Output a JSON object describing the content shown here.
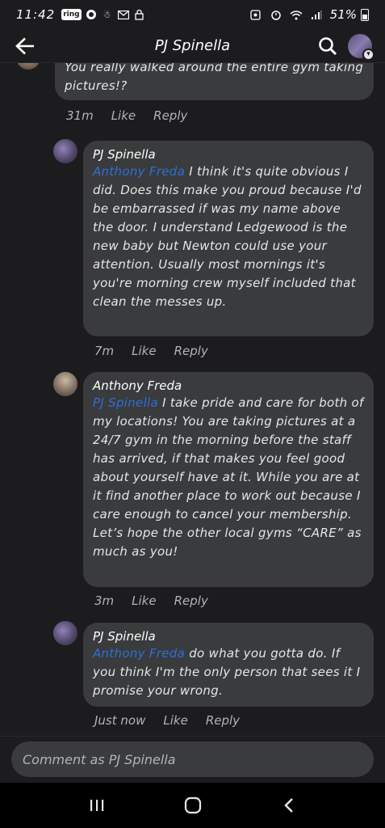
{
  "status_bar": {
    "time": "11:42",
    "ring_label": "ring",
    "battery": "51%"
  },
  "header": {
    "title": "PJ Spinella"
  },
  "comments": [
    {
      "author": "",
      "mention": "",
      "text": "You really walked around the entire gym taking pictures!?",
      "time": "31m",
      "like": "Like",
      "reply": "Reply"
    },
    {
      "author": "PJ Spinella",
      "mention": "Anthony Freda",
      "text": " I think it's quite obvious I did. Does this make you proud because I'd be embarrassed if was my name above the door. I understand Ledgewood is the new baby but Newton could use your attention. Usually most mornings it's you're morning crew myself included that clean the messes up.",
      "time": "7m",
      "like": "Like",
      "reply": "Reply"
    },
    {
      "author": "Anthony Freda",
      "mention": "PJ Spinella",
      "text": " I take pride and care for both of my locations! You are taking pictures at a 24/7 gym in the morning before the staff has arrived, if that makes you feel good about yourself have at it. While you are at it find another place to work out because I care enough to cancel your membership. Let’s hope the other local gyms “CARE” as much as you!",
      "time": "3m",
      "like": "Like",
      "reply": "Reply"
    },
    {
      "author": "PJ Spinella",
      "mention": "Anthony Freda",
      "text": " do what you gotta do. If you think I'm the only person that sees it I promise your wrong.",
      "time": "Just now",
      "like": "Like",
      "reply": "Reply"
    }
  ],
  "composer": {
    "placeholder": "Comment as PJ Spinella"
  },
  "icons": [
    "back-arrow-icon",
    "search-icon",
    "chevron-down-icon",
    "recent-apps-icon",
    "home-icon",
    "back-nav-icon"
  ]
}
